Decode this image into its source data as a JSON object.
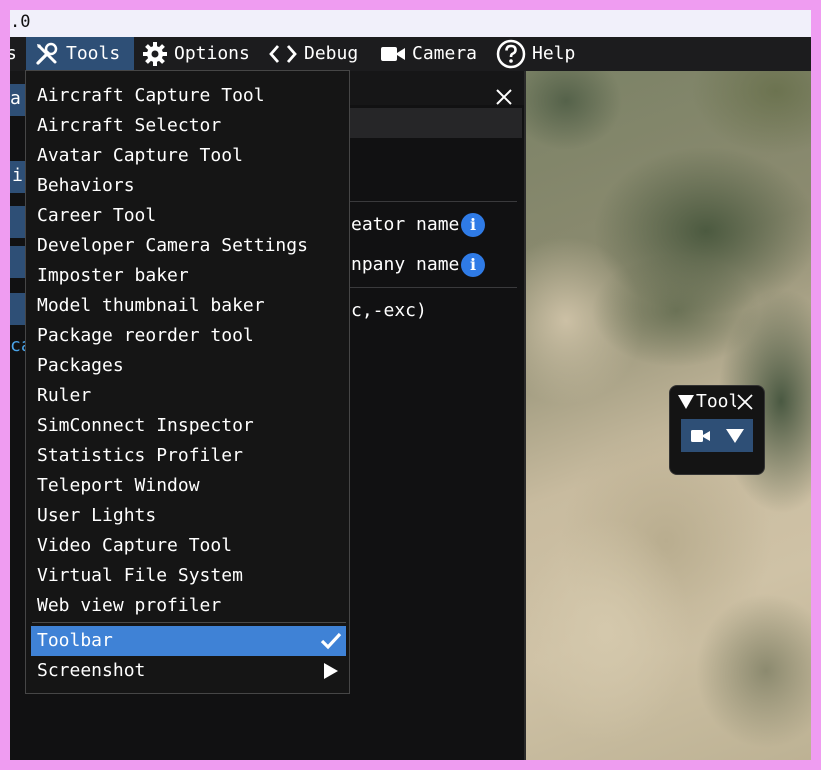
{
  "window": {
    "title_fragment": ".0"
  },
  "menubar": {
    "items": [
      {
        "id": "truncated",
        "label": "s"
      },
      {
        "id": "tools",
        "label": "Tools",
        "icon": "tools-icon"
      },
      {
        "id": "options",
        "label": "Options",
        "icon": "gear-icon"
      },
      {
        "id": "debug",
        "label": "Debug",
        "icon": "code-icon"
      },
      {
        "id": "camera",
        "label": "Camera",
        "icon": "camera-icon"
      },
      {
        "id": "help",
        "label": "Help",
        "icon": "help-icon"
      }
    ]
  },
  "editor": {
    "fields": [
      {
        "label": "eator name",
        "icon": "info-icon",
        "icon_text": "i"
      },
      {
        "label": "npany name",
        "icon": "info-icon",
        "icon_text": "i"
      }
    ],
    "args_text": "c,-exc)",
    "fragments": {
      "row1": "a",
      "row2": "i",
      "row3": "ca"
    }
  },
  "tools_menu": {
    "items": [
      "Aircraft Capture Tool",
      "Aircraft Selector",
      "Avatar Capture Tool",
      "Behaviors",
      "Career Tool",
      "Developer Camera Settings",
      "Imposter baker",
      "Model thumbnail baker",
      "Package reorder tool",
      "Packages",
      "Ruler",
      "SimConnect Inspector",
      "Statistics Profiler",
      "Teleport Window",
      "User Lights",
      "Video Capture Tool",
      "Virtual File System",
      "Web view profiler"
    ],
    "toolbar_item": {
      "label": "Toolbar",
      "checked": true
    },
    "screenshot_item": {
      "label": "Screenshot",
      "has_submenu": true
    }
  },
  "toolbar_window": {
    "title": "Toolbar"
  },
  "colors": {
    "accent_selected": "#3f82d6",
    "menu_active": "#2e4f76",
    "info_blue": "#2f7be6",
    "frame": "#ef9cf1"
  }
}
